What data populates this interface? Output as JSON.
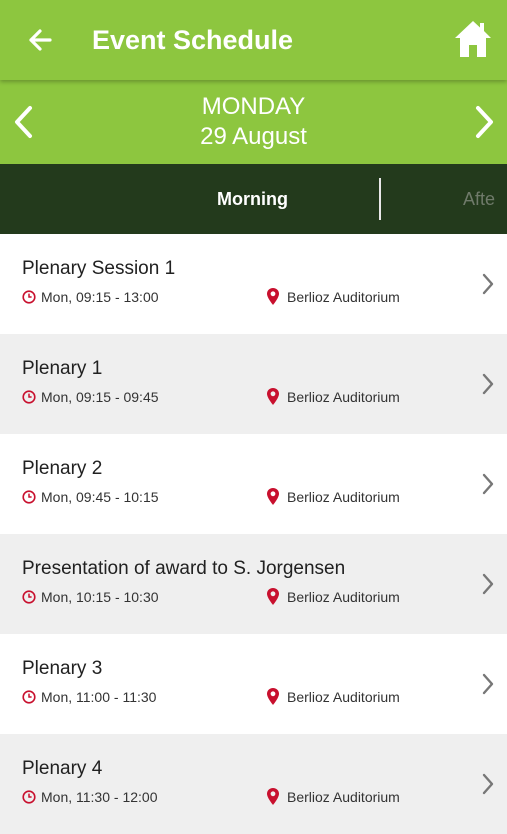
{
  "header": {
    "title": "Event Schedule",
    "back_icon": "arrow-left-icon",
    "home_icon": "home-icon",
    "background_color": "#8dc63f"
  },
  "date_nav": {
    "day": "MONDAY",
    "date": "29 August",
    "prev_icon": "chevron-left-icon",
    "next_icon": "chevron-right-icon"
  },
  "tabs": [
    {
      "label": "Morning",
      "active": true
    },
    {
      "label": "Afte",
      "active": false
    }
  ],
  "tabbar_color": "#233a1c",
  "sessions": [
    {
      "title": "Plenary Session 1",
      "time": "Mon, 09:15 - 13:00",
      "location": "Berlioz Auditorium"
    },
    {
      "title": "Plenary 1",
      "time": "Mon, 09:15 - 09:45",
      "location": "Berlioz Auditorium"
    },
    {
      "title": "Plenary 2",
      "time": "Mon, 09:45 - 10:15",
      "location": "Berlioz Auditorium"
    },
    {
      "title": "Presentation of award to S. Jorgensen",
      "time": "Mon, 10:15 - 10:30",
      "location": "Berlioz Auditorium"
    },
    {
      "title": "Plenary 3",
      "time": "Mon, 11:00 - 11:30",
      "location": "Berlioz Auditorium"
    },
    {
      "title": "Plenary 4",
      "time": "Mon, 11:30 - 12:00",
      "location": "Berlioz Auditorium"
    }
  ],
  "icon_accent_color": "#c8102e"
}
